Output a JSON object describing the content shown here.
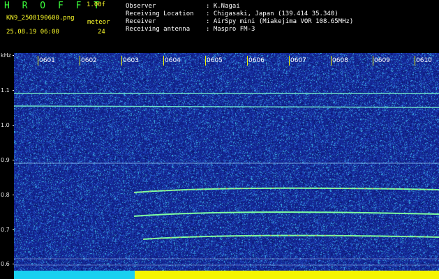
{
  "header": {
    "app_title": "H R O F F T",
    "version": "1.00f",
    "filename": "KN9_2508190600.png",
    "meteor_label": "meteor",
    "datetime": "25.08.19 06:00",
    "meteor_count": "24",
    "info": [
      {
        "key": "Observer",
        "value": ": K.Nagai"
      },
      {
        "key": "Receiving Location",
        "value": ": Chigasaki, Japan (139.414 35.340)"
      },
      {
        "key": "Receiver",
        "value": ": AirSpy mini (Miakejima VOR 108.65MHz)"
      },
      {
        "key": "Receiving antenna",
        "value": ": Maspro FM-3"
      }
    ]
  },
  "axis": {
    "unit": "kHz",
    "labels": [
      "1.1",
      "1.0",
      "0.9",
      "0.8",
      "0.7",
      "0.6"
    ]
  },
  "timeline": {
    "labels": [
      "0601",
      "0602",
      "0603",
      "0604",
      "0605",
      "0606",
      "0607",
      "0608",
      "0609",
      "0610"
    ]
  },
  "colors": {
    "background": "#000000",
    "spectrum_bg": "#1a2a9a",
    "title_green": "#3cff3c",
    "meta_yellow": "#ffff2a",
    "signal_cyan": "#7fffd0",
    "bar_cyan": "#19d0f0",
    "bar_yellow": "#f5f500"
  }
}
